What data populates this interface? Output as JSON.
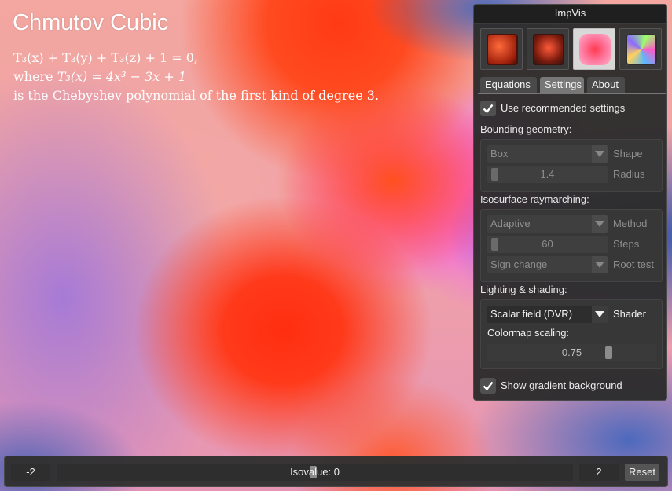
{
  "surface": {
    "title": "Chmutov Cubic",
    "equation_line1": "T₃(x) + T₃(y) + T₃(z) + 1 = 0,",
    "equation_line2_prefix": "where",
    "equation_line2_math": "T₃(x) = 4x³ − 3x + 1",
    "equation_line3": "is the Chebyshev polynomial of the first kind of degree 3."
  },
  "panel": {
    "title": "ImpVis",
    "thumbnails": [
      {
        "name": "cube-thumbnail-1",
        "selected": false
      },
      {
        "name": "cube-thumbnail-2",
        "selected": false
      },
      {
        "name": "cube-thumbnail-3",
        "selected": true
      },
      {
        "name": "cube-thumbnail-4",
        "selected": false
      }
    ],
    "tabs": {
      "equations": "Equations",
      "settings": "Settings",
      "about": "About",
      "active": "Settings"
    },
    "recommended": {
      "label": "Use recommended settings",
      "checked": true
    },
    "bounding": {
      "section": "Bounding geometry:",
      "shape_value": "Box",
      "shape_label": "Shape",
      "radius_value": "1.4",
      "radius_label": "Radius"
    },
    "raymarching": {
      "section": "Isosurface raymarching:",
      "method_value": "Adaptive",
      "method_label": "Method",
      "steps_value": "60",
      "steps_label": "Steps",
      "root_value": "Sign change",
      "root_label": "Root test"
    },
    "lighting": {
      "section": "Lighting & shading:",
      "shader_value": "Scalar field (DVR)",
      "shader_label": "Shader",
      "colormap_label": "Colormap scaling:",
      "colormap_value": "0.75"
    },
    "gradient_bg": {
      "label": "Show gradient background",
      "checked": true
    }
  },
  "isovalue": {
    "min": "-2",
    "max": "2",
    "label": "Isovalue: 0",
    "reset": "Reset"
  },
  "colors": {
    "panel_bg": "#2c2c2c",
    "accent_tab": "#777777",
    "background_red": "#ff3a1b",
    "background_pink": "#ff5ae0",
    "background_blue": "#2b5fae"
  }
}
